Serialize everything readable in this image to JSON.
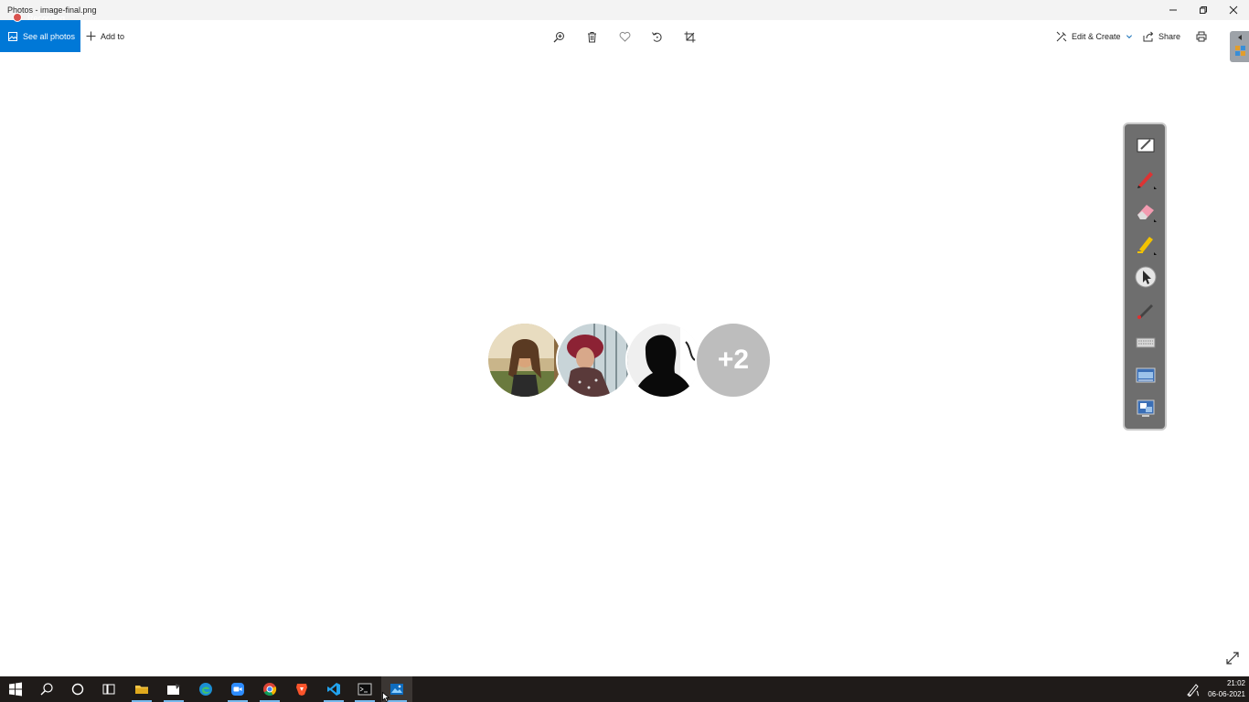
{
  "window": {
    "title": "Photos - image-final.png",
    "recording_label": "Recording"
  },
  "cmdbar": {
    "see_all_label": "See all photos",
    "add_to_label": "Add to",
    "edit_create_label": "Edit & Create",
    "share_label": "Share"
  },
  "image": {
    "more_count_label": "+2"
  },
  "taskbar": {
    "time": "21:02",
    "date": "06-06-2021"
  },
  "colors": {
    "accent": "#0078d7",
    "taskbar_bg": "#1f1b19",
    "placeholder_avatar": "#bdbdbd"
  },
  "icons": {
    "cmdbar_tools": [
      "zoom-in-icon",
      "delete-icon",
      "favorite-icon",
      "rotate-icon",
      "crop-icon"
    ],
    "pen_toolbar": [
      "whiteboard-icon",
      "pen-icon",
      "eraser-icon",
      "highlighter-icon",
      "pointer-icon",
      "laser-pen-icon",
      "keyboard-icon",
      "screen-capture-icon",
      "display-switch-icon"
    ],
    "taskbar": [
      "start-icon",
      "search-icon",
      "cortana-icon",
      "task-view-icon",
      "file-explorer-icon",
      "notes-icon",
      "edge-icon",
      "zoom-icon",
      "chrome-icon",
      "brave-icon",
      "vscode-icon",
      "terminal-icon",
      "photos-icon"
    ]
  }
}
